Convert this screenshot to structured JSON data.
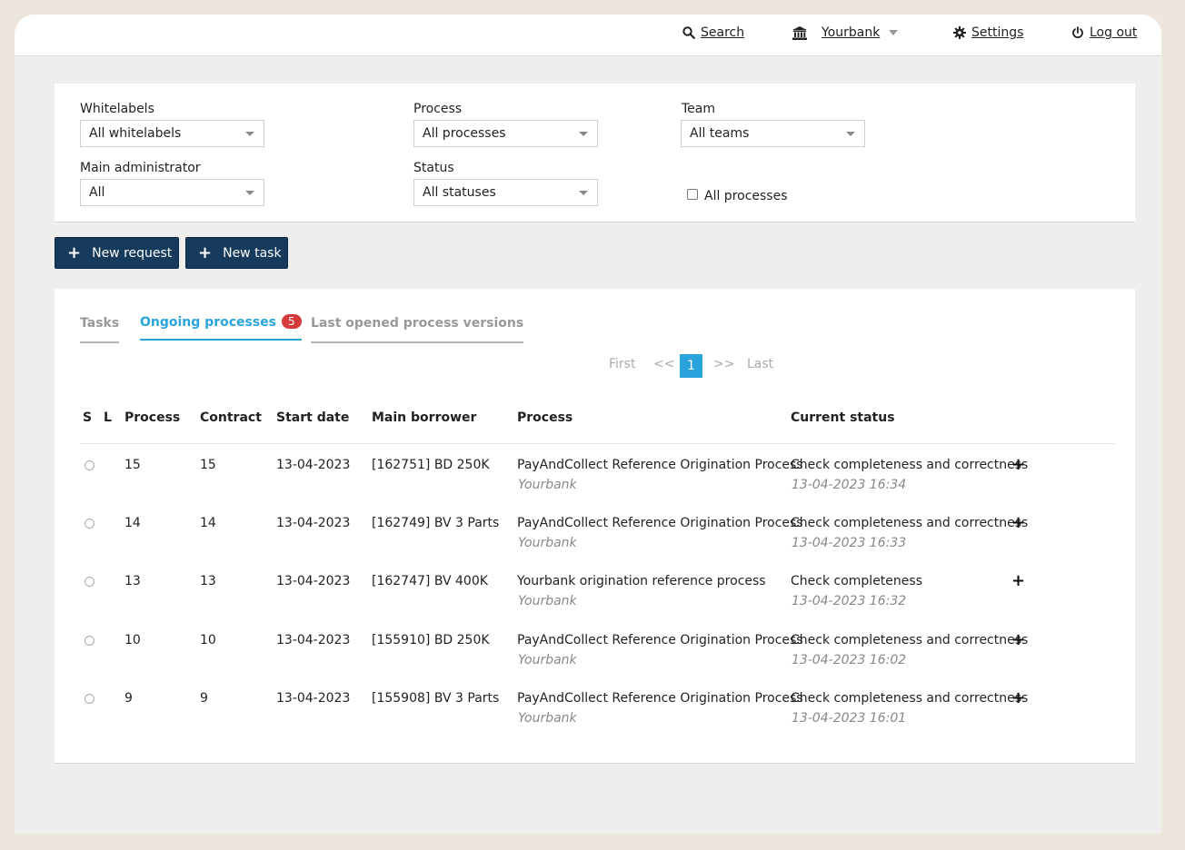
{
  "topbar": {
    "search_label": "Search",
    "bank_label": "Yourbank",
    "settings_label": "Settings",
    "logout_label": "Log out"
  },
  "filters": {
    "whitelabels": {
      "label": "Whitelabels",
      "value": "All whitelabels"
    },
    "process": {
      "label": "Process",
      "value": "All processes"
    },
    "team": {
      "label": "Team",
      "value": "All teams"
    },
    "main_admin": {
      "label": "Main administrator",
      "value": "All"
    },
    "status": {
      "label": "Status",
      "value": "All statuses"
    },
    "all_processes_checkbox": {
      "label": "All processes",
      "checked": false
    }
  },
  "actions": {
    "new_request": "New request",
    "new_task": "New task"
  },
  "tabs": [
    {
      "label": "Tasks",
      "active": false
    },
    {
      "label": "Ongoing processes",
      "active": true,
      "badge": "5"
    },
    {
      "label": "Last opened process versions",
      "active": false
    }
  ],
  "pagination": {
    "first": "First",
    "prev": "<<",
    "current": "1",
    "next": ">>",
    "last": "Last"
  },
  "table": {
    "headers": [
      "S",
      "L",
      "Process",
      "Contract",
      "Start date",
      "Main borrower",
      "Process",
      "Current status"
    ],
    "rows": [
      {
        "process": "15",
        "contract": "15",
        "start_date": "13-04-2023",
        "borrower": "[162751] BD 250K",
        "process_name": "PayAndCollect Reference Origination Process",
        "bank": "Yourbank",
        "status": "Check completeness and correctness",
        "status_time": "13-04-2023 16:34"
      },
      {
        "process": "14",
        "contract": "14",
        "start_date": "13-04-2023",
        "borrower": "[162749] BV 3 Parts",
        "process_name": "PayAndCollect Reference Origination Process",
        "bank": "Yourbank",
        "status": "Check completeness and correctness",
        "status_time": "13-04-2023 16:33"
      },
      {
        "process": "13",
        "contract": "13",
        "start_date": "13-04-2023",
        "borrower": "[162747] BV 400K",
        "process_name": "Yourbank origination reference process",
        "bank": "Yourbank",
        "status": "Check completeness",
        "status_time": "13-04-2023 16:32"
      },
      {
        "process": "10",
        "contract": "10",
        "start_date": "13-04-2023",
        "borrower": "[155910] BD 250K",
        "process_name": "PayAndCollect Reference Origination Process",
        "bank": "Yourbank",
        "status": "Check completeness and correctness",
        "status_time": "13-04-2023 16:02"
      },
      {
        "process": "9",
        "contract": "9",
        "start_date": "13-04-2023",
        "borrower": "[155908] BV 3 Parts",
        "process_name": "PayAndCollect Reference Origination Process",
        "bank": "Yourbank",
        "status": "Check completeness and correctness",
        "status_time": "13-04-2023 16:01"
      }
    ]
  },
  "icons": {
    "search": "search-icon",
    "bank": "bank-icon",
    "settings": "gear-icon",
    "logout": "power-icon",
    "add": "plus-icon"
  },
  "colors": {
    "primary_button": "#163a5c",
    "accent": "#2aa5dc",
    "badge": "#d63a3a"
  }
}
